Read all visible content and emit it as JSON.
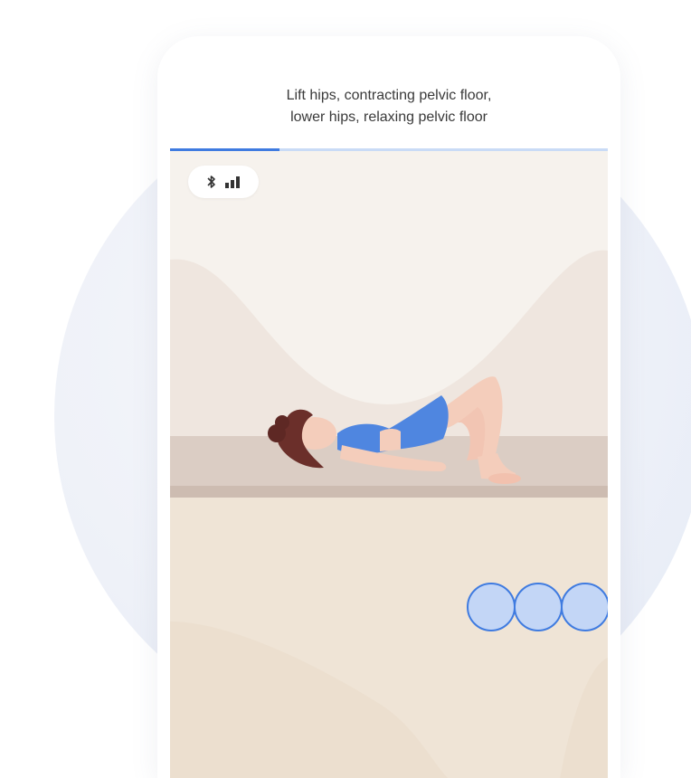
{
  "screen": {
    "instruction_lines": [
      "Lift hips, contracting pelvic floor,",
      "lower hips, relaxing pelvic floor"
    ],
    "progress_fraction": 0.25,
    "colors": {
      "accent": "#3f7be0",
      "progress_track": "#c9dbf6",
      "scene_background": "#f6f2ed",
      "mat": "#dbcdc4",
      "floor": "#efe4d6",
      "shirt": "#4f86e0",
      "bubble_fill": "#c3d6f6",
      "bubble_stroke": "#3f7be0"
    },
    "status_icons": [
      "bluetooth-icon",
      "signal-strength-icon"
    ],
    "breath_indicator_count": 3
  }
}
